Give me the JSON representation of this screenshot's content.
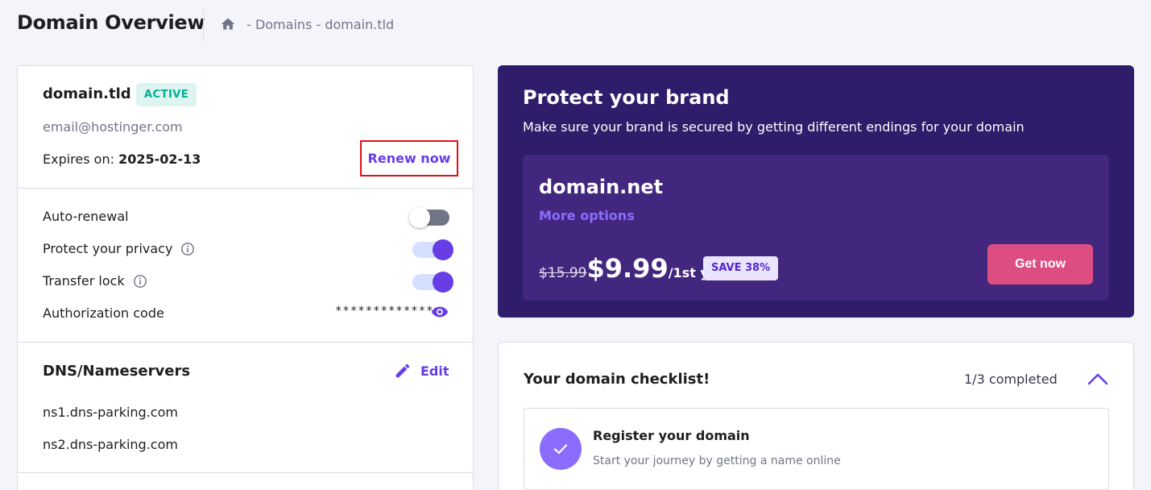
{
  "header": {
    "title": "Domain Overview",
    "breadcrumb": [
      " - Domains",
      " - domain.tld"
    ],
    "home_icon": "home-icon"
  },
  "domain_card": {
    "domain": "domain.tld",
    "status": "ACTIVE",
    "email": "email@hostinger.com",
    "expires_label": "Expires on: ",
    "expires_date": "2025-02-13",
    "renew_label": "Renew now",
    "settings": {
      "auto_renewal": {
        "label": "Auto-renewal",
        "enabled": false
      },
      "privacy": {
        "label": "Protect your privacy",
        "enabled": true
      },
      "transfer_lock": {
        "label": "Transfer lock",
        "enabled": true
      },
      "auth_code": {
        "label": "Authorization code",
        "value": "*************"
      }
    },
    "dns": {
      "title": "DNS/Nameservers",
      "edit_label": "Edit",
      "nameservers": [
        "ns1.dns-parking.com",
        "ns2.dns-parking.com"
      ]
    }
  },
  "promo": {
    "title": "Protect your brand",
    "subtitle": "Make sure your brand is secured by getting different endings for your domain",
    "offer_domain": "domain.net",
    "more_options": "More options",
    "old_price": "$15.99",
    "new_price": "$9.99",
    "period": "/1st yr",
    "save_badge": "SAVE 38%",
    "cta": "Get now"
  },
  "checklist": {
    "title": "Your domain checklist!",
    "progress": "1/3 completed",
    "tasks": [
      {
        "title": "Register your domain",
        "subtitle": "Start your journey by getting a name online",
        "done": true
      }
    ]
  },
  "colors": {
    "accent": "#673de6",
    "promo_bg": "#2f1c6a",
    "cta": "#dc4e82",
    "highlight_border": "#e0101a"
  }
}
